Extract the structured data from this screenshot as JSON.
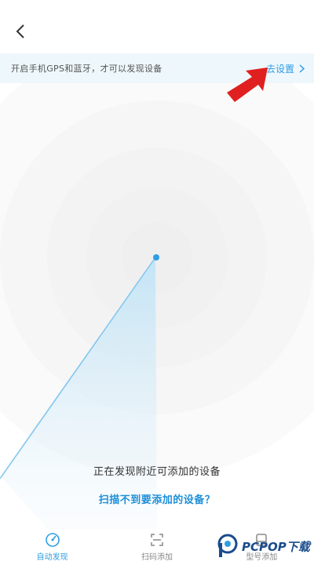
{
  "header": {
    "back_icon": "chevron-left-icon"
  },
  "banner": {
    "text": "开启手机GPS和蓝牙，才可以发现设备",
    "link_label": "去设置",
    "link_icon": "chevron-right-icon"
  },
  "scan": {
    "status_text": "正在发现附近可添加的设备",
    "help_link": "扫描不到要添加的设备？"
  },
  "tabs": [
    {
      "label": "自动发现",
      "icon": "radar-icon",
      "active": true
    },
    {
      "label": "扫码添加",
      "icon": "scan-qr-icon",
      "active": false
    },
    {
      "label": "型号添加",
      "icon": "device-model-icon",
      "active": false
    }
  ],
  "watermark": {
    "text": "PCPOP下载"
  },
  "colors": {
    "accent": "#2f9ee3",
    "banner_bg": "#eef7fc",
    "annotation_arrow": "#e02020"
  }
}
